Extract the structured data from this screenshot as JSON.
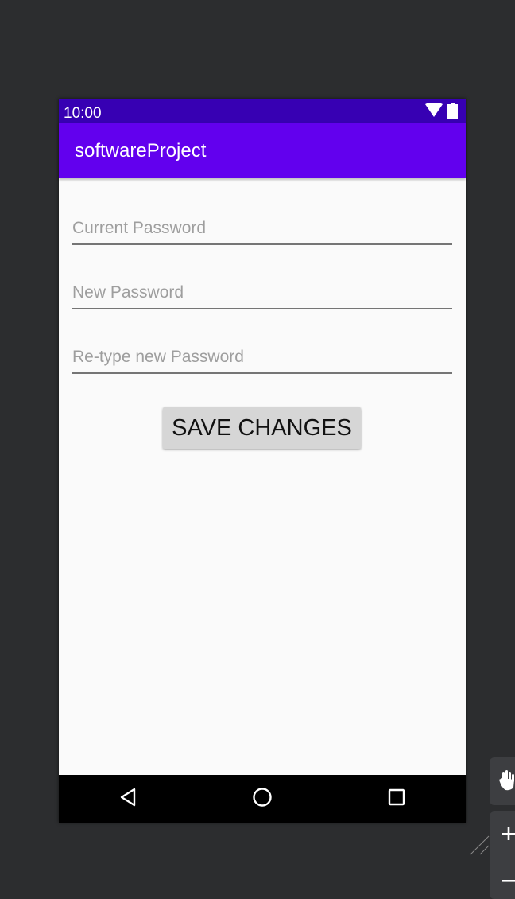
{
  "status_bar": {
    "time": "10:00",
    "icons": [
      "wifi-icon",
      "battery-icon"
    ]
  },
  "app_bar": {
    "title": "softwareProject"
  },
  "form": {
    "current_password": {
      "placeholder": "Current Password",
      "value": ""
    },
    "new_password": {
      "placeholder": "New Password",
      "value": ""
    },
    "retype_password": {
      "placeholder": "Re-type new Password",
      "value": ""
    },
    "save_label": "SAVE CHANGES"
  },
  "nav_bar": {
    "icons": [
      "back-icon",
      "home-icon",
      "recents-icon"
    ]
  },
  "side_toolbar": {
    "icons": [
      "hand-icon",
      "zoom-in-icon",
      "zoom-out-icon"
    ]
  },
  "colors": {
    "status_bar": "#3700b3",
    "app_bar": "#6200ee",
    "content_background": "#fafafa",
    "button": "#d6d6d6",
    "outer_background": "#2c2d2f"
  }
}
